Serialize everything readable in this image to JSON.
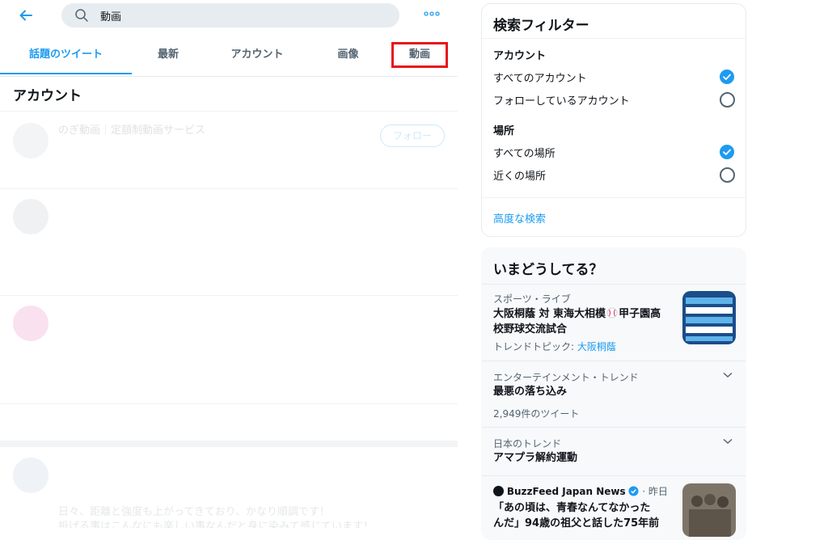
{
  "search": {
    "query": "動画"
  },
  "tabs": [
    {
      "label": "話題のツイート"
    },
    {
      "label": "最新"
    },
    {
      "label": "アカウント"
    },
    {
      "label": "画像"
    },
    {
      "label": "動画"
    }
  ],
  "accounts_section": {
    "title": "アカウント",
    "first_account_name": "のぎ動画｜定額制動画サービス",
    "follow_label": "フォロー"
  },
  "faded_tweet": {
    "line1": "日々、距離と強度も上がってきており、かなり順調です！",
    "line2": "投げる事はこんなにも楽しい事なんだと身に染みて感じています！"
  },
  "filter": {
    "title": "検索フィルター",
    "account_heading": "アカウント",
    "account_options": [
      {
        "label": "すべてのアカウント",
        "checked": true
      },
      {
        "label": "フォローしているアカウント",
        "checked": false
      }
    ],
    "place_heading": "場所",
    "place_options": [
      {
        "label": "すべての場所",
        "checked": true
      },
      {
        "label": "近くの場所",
        "checked": false
      }
    ],
    "advanced_link": "高度な検索"
  },
  "trends": {
    "title": "いまどうしてる？",
    "items": [
      {
        "category": "スポーツ・ライブ",
        "name_line1": "大阪桐蔭 対 東海大相模",
        "name_line1b": "甲子園高",
        "name_line2": "校野球交流試合",
        "topic_prefix": "トレンドトピック: ",
        "topic_link": "大阪桐蔭"
      },
      {
        "category": "エンターテインメント・トレンド",
        "name": "最悪の落ち込み",
        "meta": "2,949件のツイート"
      },
      {
        "category": "日本のトレンド",
        "name": "アマプラ解約運動"
      },
      {
        "source": "BuzzFeed Japan News",
        "time": "· 昨日",
        "headline_line1": "「あの頃は、青春なんてなかった",
        "headline_line2": "んだ」94歳の祖父と話した75年前"
      }
    ]
  },
  "colors": {
    "accent": "#1d9bf0",
    "highlight_box": "#e8141b"
  }
}
